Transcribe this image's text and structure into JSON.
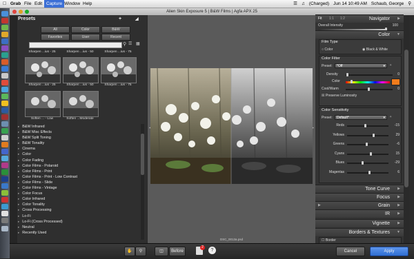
{
  "menubar": {
    "app": "Grab",
    "items": [
      "File",
      "Edit",
      "Capture",
      "Window",
      "Help"
    ],
    "status": {
      "battery": "(Charged)",
      "datetime": "Jun 14 10:49 AM",
      "user": "Schaub, George"
    }
  },
  "window": {
    "title": "Alien Skin Exposure 5 | B&W Films | Agfa APX 25"
  },
  "presets": {
    "title": "Presets",
    "filters": [
      "All",
      "Color",
      "B&W",
      "Favorites",
      "User",
      "Recent"
    ],
    "thumbnails_top_labels": [
      "Sharpen ...ius - 25",
      "Sharpen ...ius - 50",
      "Sharpen ...ius - 75"
    ],
    "thumbnails_row1_labels": [
      "Sharpen ...ius - 25",
      "Sharpen ...ius - 50",
      "Sharpen ...ius - 75"
    ],
    "thumbnails_row2_labels": [
      "Soften ... - Low",
      "Soften ...Moderate"
    ],
    "categories": [
      "B&W Infrared",
      "B&W Misc Effects",
      "B&W Split Toning",
      "B&W Tonality",
      "Cinema",
      "Color",
      "Color Fading",
      "Color Films - Polaroid",
      "Color Films - Print",
      "Color Films - Print - Low Contrast",
      "Color Films - Slide",
      "Color Films - Vintage",
      "Color Focus",
      "Color Infrared",
      "Color Tonality",
      "Cross Processing",
      "Lo-Fi",
      "Lo-Fi (Cross Processed)",
      "Neutral",
      "Recently Used"
    ]
  },
  "preview": {
    "filename": "DSC_0013a.psd"
  },
  "right_panel": {
    "zoom_tabs": [
      "Fit",
      "1:1",
      "1:2"
    ],
    "navigator": "Navigator",
    "overall_intensity_label": "Overall Intensity",
    "overall_intensity_value": "100",
    "overall_intensity_level": 1.0,
    "color_section": "Color",
    "film_type": {
      "title": "Film Type",
      "options": [
        "Color",
        "Black & White"
      ],
      "selected": "Black & White"
    },
    "color_filter": {
      "title": "Color Filter",
      "preset_label": "Preset:",
      "preset_value": "*Off",
      "density_label": "Density",
      "density_value": "0",
      "color_label": "Color",
      "swatch_color": "#f07c1c",
      "coolwarm_label": "Cool/Warm",
      "coolwarm_value": "0",
      "preserve_label": "Preserve Luminosity",
      "preserve_checked": true
    },
    "color_sensitivity": {
      "title": "Color Sensitivity",
      "preset_label": "Preset:",
      "preset_value": "Default*",
      "channels": [
        {
          "name": "Reds",
          "value": "-15"
        },
        {
          "name": "Yellows",
          "value": "29"
        },
        {
          "name": "Greens",
          "value": "-6"
        },
        {
          "name": "Cyans",
          "value": "15"
        },
        {
          "name": "Blues",
          "value": "-29"
        },
        {
          "name": "Magentas",
          "value": "6"
        }
      ]
    },
    "sections": [
      "Tone Curve",
      "Focus",
      "Grain",
      "IR",
      "Vignette",
      "Borders & Textures"
    ],
    "border_label": "Border"
  },
  "bottom": {
    "before_label": "Before",
    "cancel_label": "Cancel",
    "apply_label": "Apply",
    "notification_count": "2",
    "accent_apply": "#2f6ed3"
  }
}
